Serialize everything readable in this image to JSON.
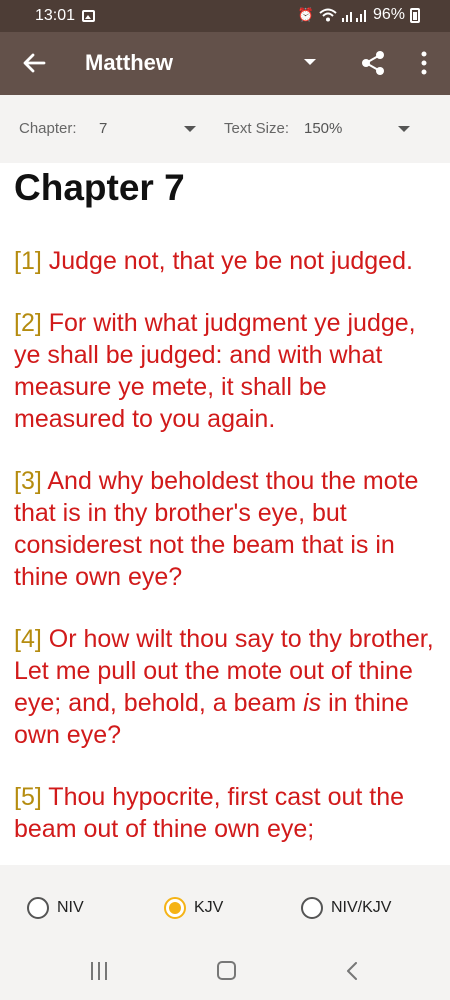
{
  "status_bar": {
    "time": "13:01",
    "battery": "96%",
    "icons": [
      "image-icon",
      "alarm-icon",
      "wifi-icon",
      "signal-icon",
      "battery-icon"
    ]
  },
  "app_bar": {
    "title": "Matthew",
    "icons": [
      "back-arrow-icon",
      "dropdown-icon",
      "share-icon",
      "more-vert-icon"
    ],
    "color": "#63514a"
  },
  "controls": {
    "chapter_label": "Chapter:",
    "chapter_value": "7",
    "text_size_label": "Text Size:",
    "text_size_value": "150%"
  },
  "content": {
    "chapter_title": "Chapter 7",
    "verse_color": "#d11a1a",
    "verse_number_color": "#b58c10",
    "verses": [
      {
        "num": "[1]",
        "text": "Judge not, that ye be not judged."
      },
      {
        "num": "[2]",
        "text": "For with what judgment ye judge, ye shall be judged: and with what measure ye mete, it shall be measured to you again."
      },
      {
        "num": "[3]",
        "text": "And why beholdest thou the mote that is in thy brother's eye, but considerest not the beam that is in thine own eye?"
      },
      {
        "num": "[4]",
        "pre": "Or how wilt thou say to thy brother, Let me pull out the mote out of thine eye; and, behold, a beam ",
        "em": "is",
        "post": " in thine own eye?"
      },
      {
        "num": "[5]",
        "text": "Thou hypocrite, first cast out the beam out of thine own eye;"
      }
    ]
  },
  "versions": {
    "options": [
      "NIV",
      "KJV",
      "NIV/KJV"
    ],
    "selected": "KJV",
    "accent": "#f5b316"
  },
  "nav_bar": {
    "icons": [
      "recent-apps-icon",
      "home-icon",
      "back-icon"
    ]
  }
}
